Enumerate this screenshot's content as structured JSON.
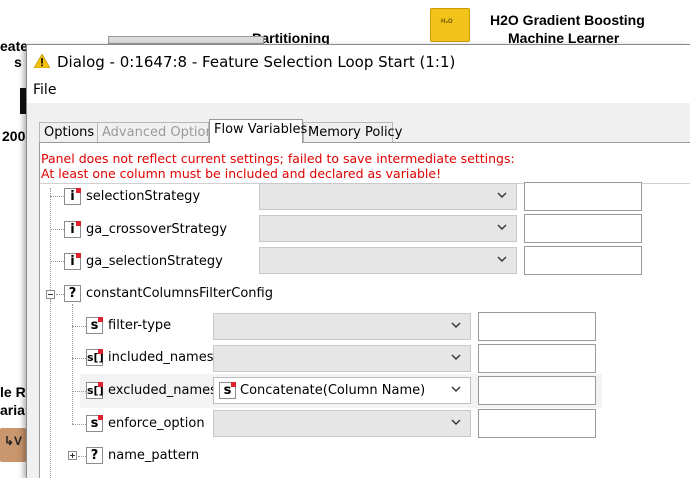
{
  "background": {
    "node_labels": [
      "H2O Gradient Boosting",
      "Machine Learner",
      "Partitioning",
      "eate",
      "s",
      "200",
      "le R",
      "aria"
    ],
    "node_badge": "H₂O",
    "orange_node_label": "↳V"
  },
  "dialog": {
    "title": "Dialog - 0:1647:8 - Feature Selection Loop Start (1:1)",
    "menu": {
      "file": "File"
    },
    "tabs": [
      {
        "label": "Options",
        "state": "normal"
      },
      {
        "label": "Advanced Options",
        "state": "disabled"
      },
      {
        "label": "Flow Variables",
        "state": "active"
      },
      {
        "label": "Memory Policy",
        "state": "normal"
      }
    ],
    "errors": [
      "Panel does not reflect current settings; failed to save intermediate settings:",
      "At least one column must be included and declared as variable!"
    ],
    "rows": [
      {
        "icon": "i",
        "label": "selectionStrategy",
        "selected": "",
        "text": ""
      },
      {
        "icon": "i",
        "label": "ga_crossoverStrategy",
        "selected": "",
        "text": ""
      },
      {
        "icon": "i",
        "label": "ga_selectionStrategy",
        "selected": "",
        "text": ""
      },
      {
        "icon": "?",
        "label": "constantColumnsFilterConfig",
        "group": true
      },
      {
        "icon": "s",
        "label": "filter-type",
        "selected": "",
        "text": ""
      },
      {
        "icon": "s[]",
        "label": "included_names",
        "selected": "",
        "text": ""
      },
      {
        "icon": "s[]",
        "label": "excluded_names",
        "selected": "Concatenate(Column Name)",
        "selected_icon": "s",
        "text": ""
      },
      {
        "icon": "s",
        "label": "enforce_option",
        "selected": "",
        "text": ""
      },
      {
        "icon": "?",
        "label": "name_pattern",
        "group": true
      }
    ]
  },
  "colors": {
    "error": "#e00000",
    "marker": "#e0202e",
    "accent_yellow": "#f2c31a"
  }
}
